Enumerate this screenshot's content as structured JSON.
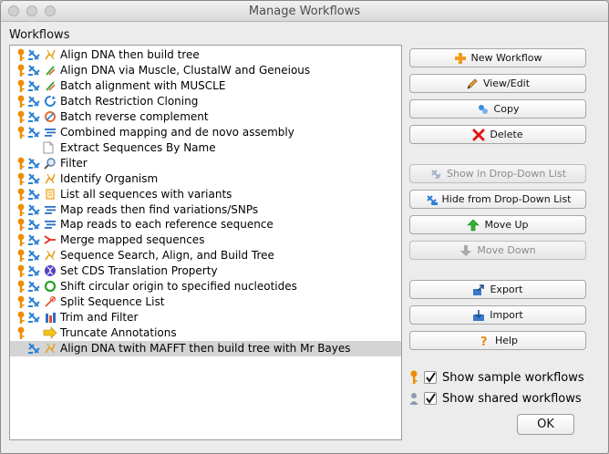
{
  "window": {
    "title": "Manage Workflows"
  },
  "list": {
    "heading": "Workflows",
    "items": [
      {
        "label": "Align DNA then build tree",
        "icons": [
          "sample-key-icon",
          "dropdown-shown-icon",
          "tree-icon"
        ]
      },
      {
        "label": "Align DNA via Muscle, ClustalW and Geneious",
        "icons": [
          "sample-key-icon",
          "dropdown-shown-icon",
          "align-icon"
        ]
      },
      {
        "label": "Batch alignment with MUSCLE",
        "icons": [
          "sample-key-icon",
          "dropdown-shown-icon",
          "align-icon"
        ]
      },
      {
        "label": "Batch Restriction Cloning",
        "icons": [
          "sample-key-icon",
          "dropdown-shown-icon",
          "cycle-icon"
        ]
      },
      {
        "label": "Batch reverse complement",
        "icons": [
          "sample-key-icon",
          "dropdown-shown-icon",
          "reverse-complement-icon"
        ]
      },
      {
        "label": "Combined mapping and de novo assembly",
        "icons": [
          "sample-key-icon",
          "dropdown-shown-icon",
          "assembly-icon"
        ]
      },
      {
        "label": "Extract Sequences By Name",
        "icons": [
          "document-icon"
        ]
      },
      {
        "label": "Filter",
        "icons": [
          "sample-key-icon",
          "dropdown-shown-icon",
          "filter-icon"
        ]
      },
      {
        "label": "Identify Organism",
        "icons": [
          "sample-key-icon",
          "dropdown-shown-icon",
          "tree-icon"
        ]
      },
      {
        "label": "List all sequences with variants",
        "icons": [
          "sample-key-icon",
          "dropdown-shown-icon",
          "variants-icon"
        ]
      },
      {
        "label": "Map reads then find variations/SNPs",
        "icons": [
          "sample-key-icon",
          "dropdown-shown-icon",
          "assembly-icon"
        ]
      },
      {
        "label": "Map reads to each reference sequence",
        "icons": [
          "sample-key-icon",
          "dropdown-shown-icon",
          "assembly-icon"
        ]
      },
      {
        "label": "Merge mapped sequences",
        "icons": [
          "sample-key-icon",
          "dropdown-shown-icon",
          "merge-icon"
        ]
      },
      {
        "label": "Sequence Search, Align, and Build Tree",
        "icons": [
          "sample-key-icon",
          "dropdown-shown-icon",
          "tree-icon"
        ]
      },
      {
        "label": "Set CDS Translation Property",
        "icons": [
          "sample-key-icon",
          "dropdown-shown-icon",
          "dna-helix-icon"
        ]
      },
      {
        "label": "Shift circular origin to specified nucleotides",
        "icons": [
          "sample-key-icon",
          "dropdown-shown-icon",
          "circle-icon"
        ]
      },
      {
        "label": "Split Sequence List",
        "icons": [
          "sample-key-icon",
          "dropdown-shown-icon",
          "split-icon"
        ]
      },
      {
        "label": "Trim and Filter",
        "icons": [
          "sample-key-icon",
          "dropdown-shown-icon",
          "trim-icon"
        ]
      },
      {
        "label": "Truncate Annotations",
        "icons": [
          "sample-key-icon",
          "arrow-right-icon"
        ]
      },
      {
        "label": "Align DNA twith MAFFT then build tree with Mr Bayes",
        "icons": [
          "dropdown-shown-icon",
          "tree-icon"
        ],
        "selected": true
      }
    ]
  },
  "buttons": {
    "new_workflow": "New Workflow",
    "view_edit": "View/Edit",
    "copy": "Copy",
    "delete": "Delete",
    "show_in_dropdown": "Show in Drop-Down List",
    "hide_from_dropdown": "Hide from Drop-Down List",
    "move_up": "Move Up",
    "move_down": "Move Down",
    "export": "Export",
    "import": "Import",
    "help": "Help",
    "ok": "OK"
  },
  "options": {
    "show_sample_label": "Show sample workflows",
    "show_sample_checked": true,
    "show_shared_label": "Show shared workflows",
    "show_shared_checked": true
  },
  "colors": {
    "selection": "#d4d4d4",
    "sample_key": "#f08c00",
    "dropdown_icon": "#2a7fd4",
    "up_green": "#2db52d",
    "delete_red": "#e01818"
  }
}
